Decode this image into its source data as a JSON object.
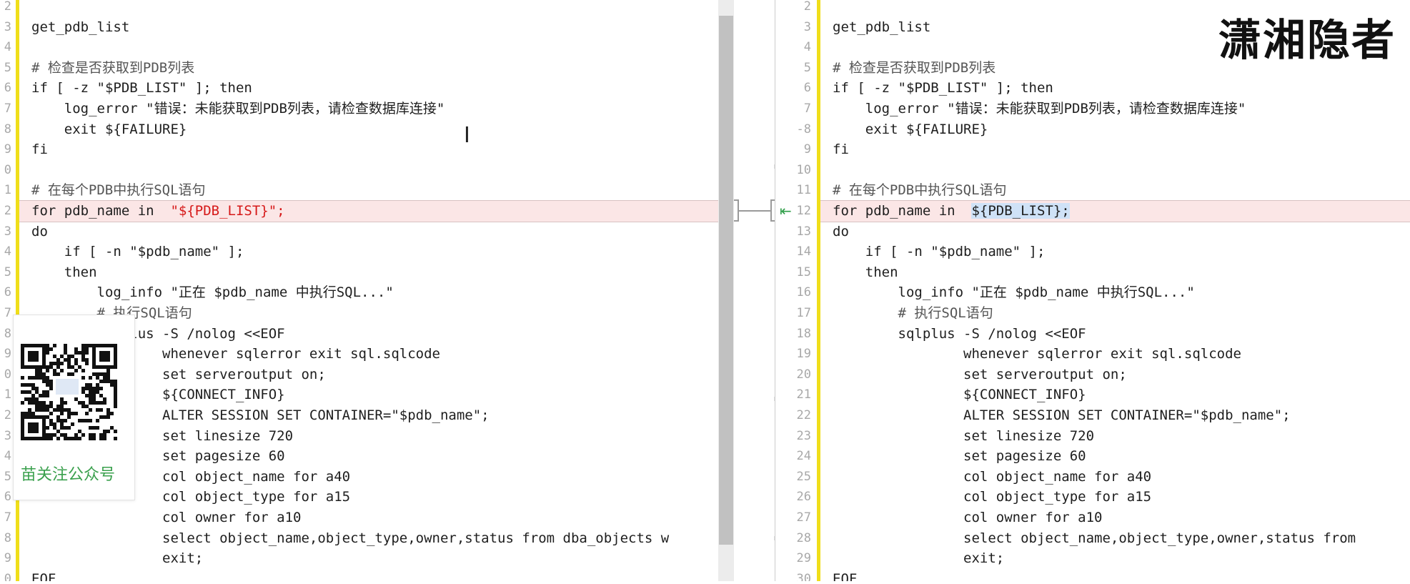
{
  "watermark": "潇湘隐者",
  "qr_caption": "苗关注公众号",
  "cursor_glyph": "I",
  "arrow_glyph": "⇤",
  "left": {
    "lines": [
      {
        "num": "2",
        "text": ""
      },
      {
        "num": "3",
        "text": "get_pdb_list"
      },
      {
        "num": "4",
        "text": ""
      },
      {
        "num": "5",
        "text": "# 检查是否获取到PDB列表"
      },
      {
        "num": "6",
        "text": "if [ -z \"$PDB_LIST\" ]; then"
      },
      {
        "num": "7",
        "text": "    log_error \"错误：未能获取到PDB列表，请检查数据库连接\""
      },
      {
        "num": "8",
        "text": "    exit ${FAILURE}"
      },
      {
        "num": "9",
        "text": "fi"
      },
      {
        "num": "0",
        "text": ""
      },
      {
        "num": "1",
        "text": "# 在每个PDB中执行SQL语句"
      },
      {
        "num": "2",
        "text": "for pdb_name in  \"${PDB_LIST}\";"
      },
      {
        "num": "3",
        "text": "do"
      },
      {
        "num": "4",
        "text": "    if [ -n \"$pdb_name\" ];"
      },
      {
        "num": "5",
        "text": "    then"
      },
      {
        "num": "6",
        "text": "        log_info \"正在 $pdb_name 中执行SQL...\""
      },
      {
        "num": "7",
        "text": "        # 执行SQL语句"
      },
      {
        "num": "8",
        "text": "        sqlplus -S /nolog <<EOF"
      },
      {
        "num": "9",
        "text": "                whenever sqlerror exit sql.sqlcode"
      },
      {
        "num": "0",
        "text": "                set serveroutput on;"
      },
      {
        "num": "1",
        "text": "                ${CONNECT_INFO}"
      },
      {
        "num": "2",
        "text": "                ALTER SESSION SET CONTAINER=\"$pdb_name\";"
      },
      {
        "num": "3",
        "text": "                set linesize 720"
      },
      {
        "num": "4",
        "text": "                set pagesize 60"
      },
      {
        "num": "5",
        "text": "                col object_name for a40"
      },
      {
        "num": "6",
        "text": "                col object_type for a15"
      },
      {
        "num": "7",
        "text": "                col owner for a10"
      },
      {
        "num": "8",
        "text": "                select object_name,object_type,owner,status from dba_objects w"
      },
      {
        "num": "9",
        "text": "                exit;"
      },
      {
        "num": "0",
        "text": "EOF"
      }
    ],
    "diff_line": {
      "prefix": "for pdb_name in  ",
      "changed": "\"${PDB_LIST}\";"
    }
  },
  "right": {
    "lines": [
      {
        "num": "2",
        "text": ""
      },
      {
        "num": "3",
        "text": "get_pdb_list"
      },
      {
        "num": "4",
        "text": ""
      },
      {
        "num": "5",
        "text": "# 检查是否获取到PDB列表"
      },
      {
        "num": "6",
        "text": "if [ -z \"$PDB_LIST\" ]; then"
      },
      {
        "num": "7",
        "text": "    log_error \"错误：未能获取到PDB列表，请检查数据库连接\""
      },
      {
        "num": "-8",
        "text": "    exit ${FAILURE}"
      },
      {
        "num": "9",
        "text": "fi"
      },
      {
        "num": "10",
        "text": ""
      },
      {
        "num": "11",
        "text": "# 在每个PDB中执行SQL语句"
      },
      {
        "num": "12",
        "text": "for pdb_name in  ${PDB_LIST};"
      },
      {
        "num": "13",
        "text": "do"
      },
      {
        "num": "14",
        "text": "    if [ -n \"$pdb_name\" ];"
      },
      {
        "num": "15",
        "text": "    then"
      },
      {
        "num": "16",
        "text": "        log_info \"正在 $pdb_name 中执行SQL...\""
      },
      {
        "num": "17",
        "text": "        # 执行SQL语句"
      },
      {
        "num": "18",
        "text": "        sqlplus -S /nolog <<EOF"
      },
      {
        "num": "19",
        "text": "                whenever sqlerror exit sql.sqlcode"
      },
      {
        "num": "20",
        "text": "                set serveroutput on;"
      },
      {
        "num": "21",
        "text": "                ${CONNECT_INFO}"
      },
      {
        "num": "22",
        "text": "                ALTER SESSION SET CONTAINER=\"$pdb_name\";"
      },
      {
        "num": "23",
        "text": "                set linesize 720"
      },
      {
        "num": "24",
        "text": "                set pagesize 60"
      },
      {
        "num": "25",
        "text": "                col object_name for a40"
      },
      {
        "num": "26",
        "text": "                col object_type for a15"
      },
      {
        "num": "27",
        "text": "                col owner for a10"
      },
      {
        "num": "28",
        "text": "                select object_name,object_type,owner,status from"
      },
      {
        "num": "29",
        "text": "                exit;"
      },
      {
        "num": "30",
        "text": "EOF"
      }
    ],
    "diff_line": {
      "prefix": "for pdb_name in  ",
      "changed": "${PDB_LIST};"
    }
  },
  "colors": {
    "diff_bg": "#fbe6e6",
    "changed_left": "#d61818",
    "changed_right_bg": "#cfe2f7",
    "gutter_bar": "#f0de1a",
    "arrow": "#2e9e48"
  }
}
